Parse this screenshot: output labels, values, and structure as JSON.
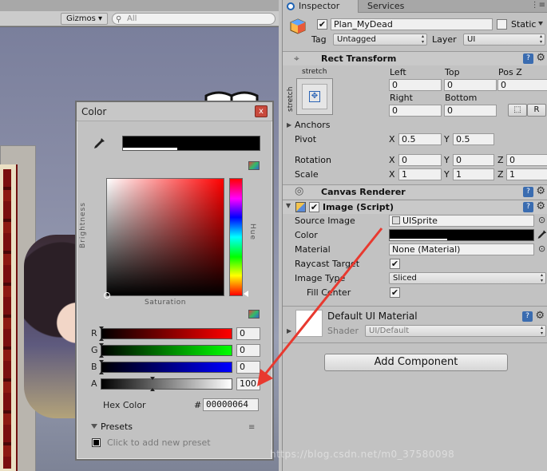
{
  "scene": {
    "gizmos_label": "Gizmos ▾",
    "search_placeholder": "All"
  },
  "color_picker": {
    "title": "Color",
    "close_glyph": "x",
    "brightness_label": "Brightness",
    "hue_label": "Hue",
    "saturation_label": "Saturation",
    "sliders": [
      {
        "label": "R",
        "value": "0"
      },
      {
        "label": "G",
        "value": "0"
      },
      {
        "label": "B",
        "value": "0"
      },
      {
        "label": "A",
        "value": "100"
      }
    ],
    "alpha_fraction": 0.39,
    "hex_label": "Hex Color",
    "hex_hash": "#",
    "hex_value": "00000064",
    "presets_label": "Presets",
    "presets_hint": "Click to add new preset",
    "current_color": "#000000"
  },
  "inspector": {
    "tabs": [
      "Inspector",
      "Services"
    ],
    "object_name": "Plan_MyDead",
    "static_label": "Static",
    "tag_label": "Tag",
    "tag_value": "Untagged",
    "layer_label": "Layer",
    "layer_value": "UI",
    "rect_transform": {
      "title": "Rect Transform",
      "stretch": "stretch",
      "col_labels": [
        "Left",
        "Top",
        "Pos Z"
      ],
      "col_values": [
        "0",
        "0",
        "0"
      ],
      "col2_labels": [
        "Right",
        "Bottom"
      ],
      "col2_values": [
        "0",
        "0"
      ],
      "r_button": "R",
      "anchors_label": "Anchors",
      "pivot_label": "Pivot",
      "pivot": {
        "x": "0.5",
        "y": "0.5"
      },
      "rotation_label": "Rotation",
      "rotation": {
        "x": "0",
        "y": "0",
        "z": "0"
      },
      "scale_label": "Scale",
      "scale": {
        "x": "1",
        "y": "1",
        "z": "1"
      }
    },
    "canvas_renderer": {
      "title": "Canvas Renderer"
    },
    "image": {
      "title": "Image (Script)",
      "source_image_label": "Source Image",
      "source_image_value": "UISprite",
      "color_label": "Color",
      "material_label": "Material",
      "material_value": "None (Material)",
      "raycast_label": "Raycast Target",
      "image_type_label": "Image Type",
      "image_type_value": "Sliced",
      "fill_center_label": "Fill Center"
    },
    "material": {
      "name": "Default UI Material",
      "shader_label": "Shader",
      "shader_value": "UI/Default"
    },
    "add_component": "Add Component"
  },
  "axis_letters": {
    "x": "X",
    "y": "Y",
    "z": "Z"
  },
  "watermark": "https://blog.csdn.net/m0_37580098",
  "colors": {
    "annotation_arrow": "#e8392f",
    "panel_bg": "#c2c2c2",
    "help_icon": "#3a6cb0"
  }
}
